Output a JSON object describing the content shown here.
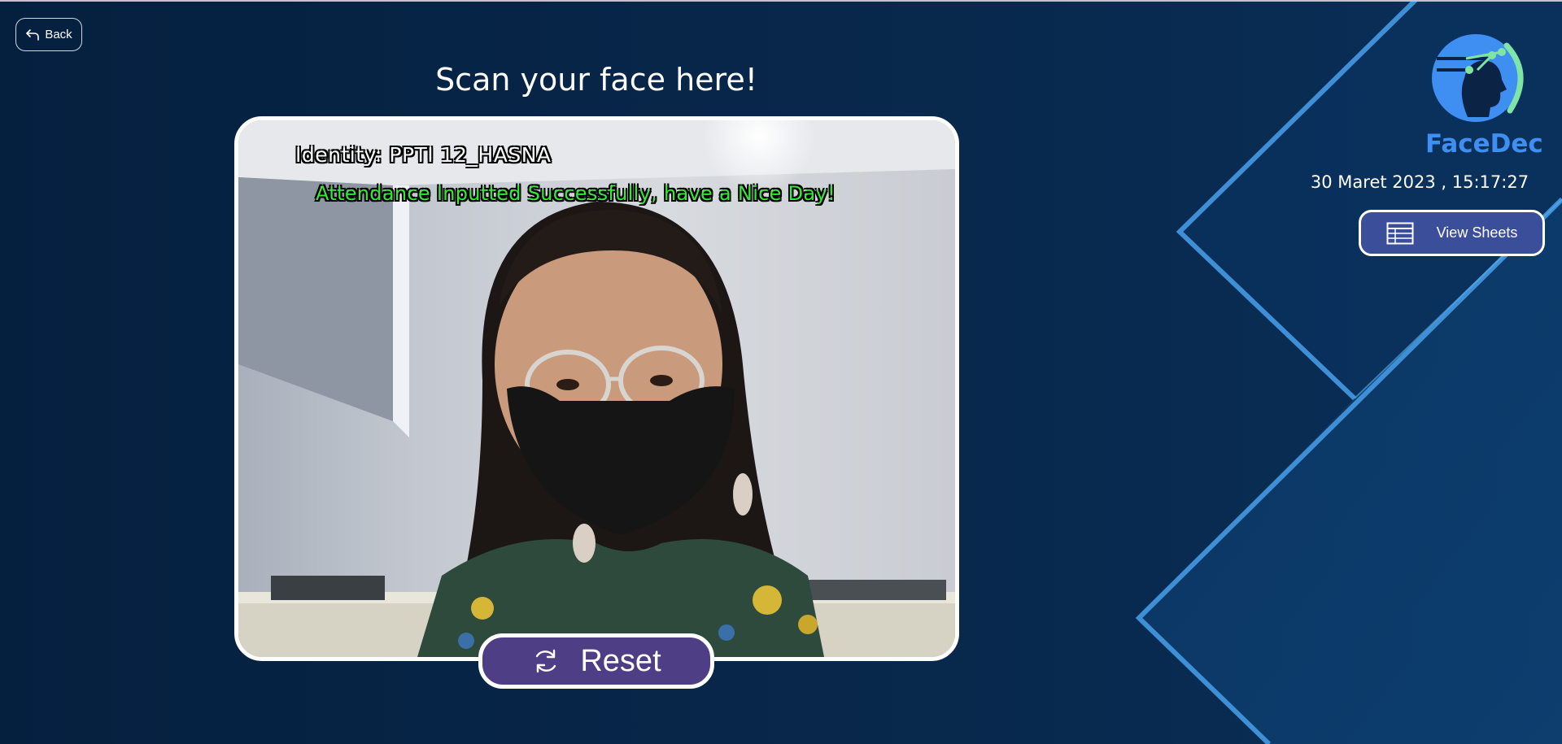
{
  "nav": {
    "back_label": "Back"
  },
  "scan": {
    "title": "Scan your face here!",
    "identity_text": "Identity: PPTI 12_HASNA",
    "status_text": "Attendance Inputted Successfully, have a Nice Day!"
  },
  "actions": {
    "reset_label": "Reset",
    "view_sheets_label": "View Sheets"
  },
  "brand": {
    "name": "FaceDec"
  },
  "datetime": "30 Maret 2023 , 15:17:27",
  "icons": {
    "back": "back-arrow-icon",
    "reset": "refresh-icon",
    "sheets": "table-icon",
    "logo": "face-circuit-logo-icon"
  },
  "colors": {
    "background": "#0b2446",
    "accent_blue": "#3f8ef2",
    "reset_button": "#4e3e86",
    "sheets_button": "#3a4e9a",
    "status_green": "#35e83a"
  }
}
